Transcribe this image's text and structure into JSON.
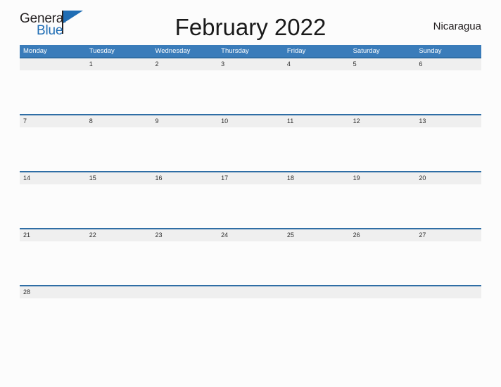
{
  "brand": {
    "name_part1": "General",
    "name_part2": "Blue",
    "flag_icon": "triangle-flag-icon",
    "color_dark": "#231f20",
    "color_blue": "#1f6db4"
  },
  "header": {
    "title": "February 2022",
    "region": "Nicaragua"
  },
  "theme": {
    "header_blue": "#3a7cba",
    "separator_blue": "#2f6ea5",
    "strip_gray": "#efefef",
    "page_background": "#fcfcfc",
    "text_dark": "#231f20"
  },
  "calendar": {
    "month": "February",
    "year": "2022",
    "weekday_headers": [
      "Monday",
      "Tuesday",
      "Wednesday",
      "Thursday",
      "Friday",
      "Saturday",
      "Sunday"
    ],
    "weeks": [
      {
        "days": [
          "",
          "1",
          "2",
          "3",
          "4",
          "5",
          "6"
        ]
      },
      {
        "days": [
          "7",
          "8",
          "9",
          "10",
          "11",
          "12",
          "13"
        ]
      },
      {
        "days": [
          "14",
          "15",
          "16",
          "17",
          "18",
          "19",
          "20"
        ]
      },
      {
        "days": [
          "21",
          "22",
          "23",
          "24",
          "25",
          "26",
          "27"
        ]
      },
      {
        "days": [
          "28",
          "",
          "",
          "",
          "",
          "",
          ""
        ]
      }
    ]
  }
}
